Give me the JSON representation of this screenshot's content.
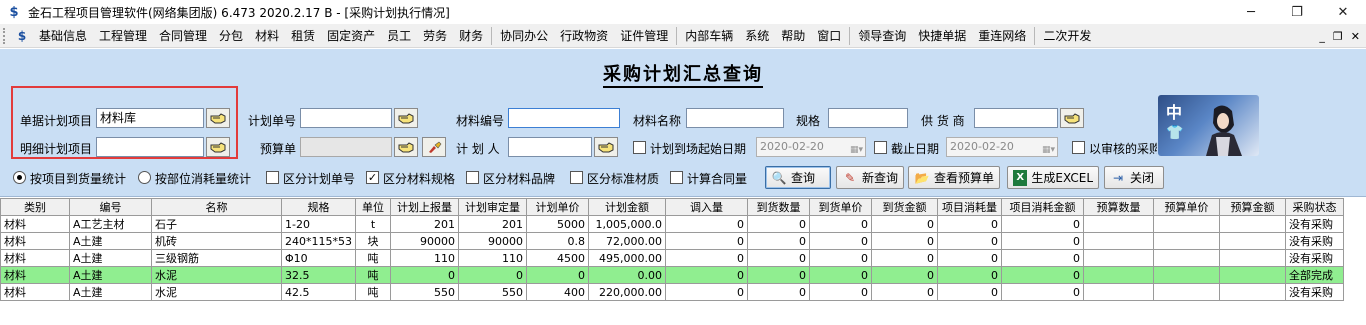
{
  "window": {
    "title": "金石工程项目管理软件(网络集团版) 6.473  2020.2.17 B - [采购计划执行情况]",
    "minimize": "─",
    "maximize": "❐",
    "close": "✕"
  },
  "menu": {
    "items": [
      "基础信息",
      "工程管理",
      "合同管理",
      "分包",
      "材料",
      "租赁",
      "固定资产",
      "员工",
      "劳务",
      "财务",
      "协同办公",
      "行政物资",
      "证件管理",
      "内部车辆",
      "系统",
      "帮助",
      "窗口",
      "领导查询",
      "快捷单据",
      "重连网络",
      "二次开发"
    ],
    "right_controls": [
      "_",
      "❐",
      "✕"
    ]
  },
  "panel": {
    "title": "采购计划汇总查询",
    "fields": {
      "plan_item_label": "单据计划项目",
      "plan_item_value": "材料库",
      "detail_item_label": "明细计划项目",
      "detail_item_value": "",
      "plan_no_label": "计划单号",
      "plan_no_value": "",
      "budget_label": "预算单",
      "budget_value": "",
      "material_code_label": "材料编号",
      "material_code_value": "",
      "planner_label": "计 划 人",
      "planner_value": "",
      "material_name_label": "材料名称",
      "material_name_value": "",
      "spec_label": "规格",
      "spec_value": "",
      "supplier_label": "供 货 商",
      "supplier_value": "",
      "arrival_start_label": "计划到场起始日期",
      "arrival_start_value": "2020-02-20",
      "end_date_label": "截止日期",
      "end_date_value": "2020-02-20",
      "approved_label": "以审核的采购"
    },
    "options": {
      "radio_by_item": "按项目到货量统计",
      "radio_by_dept": "按部位消耗量统计",
      "chk_plan_no": "区分计划单号",
      "chk_spec": "区分材料规格",
      "chk_brand": "区分材料品牌",
      "chk_standard": "区分标准材质",
      "chk_contract": "计算合同量"
    },
    "buttons": {
      "query": "查询",
      "new_query": "新查询",
      "view_budget": "查看预算单",
      "export_excel": "生成EXCEL",
      "close": "关闭"
    },
    "avatar_text": "中"
  },
  "table": {
    "columns": [
      "类别",
      "编号",
      "名称",
      "规格",
      "单位",
      "计划上报量",
      "计划审定量",
      "计划单价",
      "计划金额",
      "调入量",
      "到货数量",
      "到货单价",
      "到货金额",
      "项目消耗量",
      "项目消耗金额",
      "预算数量",
      "预算单价",
      "预算金额",
      "采购状态"
    ],
    "rows": [
      [
        "材料",
        "A工艺主材",
        "石子",
        "1-20",
        "t",
        "201",
        "201",
        "5000",
        "1,005,000.0",
        "0",
        "0",
        "0",
        "0",
        "0",
        "0",
        "",
        "",
        "",
        "没有采购"
      ],
      [
        "材料",
        "A土建",
        "机砖",
        "240*115*53",
        "块",
        "90000",
        "90000",
        "0.8",
        "72,000.00",
        "0",
        "0",
        "0",
        "0",
        "0",
        "0",
        "",
        "",
        "",
        "没有采购"
      ],
      [
        "材料",
        "A土建",
        "三级钢筋",
        "Φ10",
        "吨",
        "110",
        "110",
        "4500",
        "495,000.00",
        "0",
        "0",
        "0",
        "0",
        "0",
        "0",
        "",
        "",
        "",
        "没有采购"
      ],
      [
        "材料",
        "A土建",
        "水泥",
        "32.5",
        "吨",
        "0",
        "0",
        "0",
        "0.00",
        "0",
        "0",
        "0",
        "0",
        "0",
        "0",
        "",
        "",
        "",
        "全部完成"
      ],
      [
        "材料",
        "A土建",
        "水泥",
        "42.5",
        "吨",
        "550",
        "550",
        "400",
        "220,000.00",
        "0",
        "0",
        "0",
        "0",
        "0",
        "0",
        "",
        "",
        "",
        "没有采购"
      ]
    ],
    "completed_row_index": 3,
    "colors": {
      "completed_row": "#90ee90",
      "panel_bg": "#c9def4",
      "highlight_box": "#e23b3b"
    }
  }
}
